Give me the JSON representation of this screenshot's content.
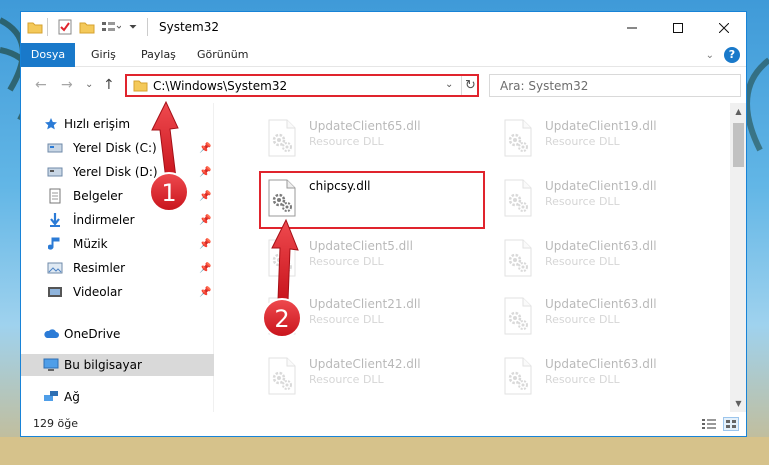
{
  "window": {
    "title": "System32"
  },
  "ribbon": {
    "tabs": [
      "Dosya",
      "Giriş",
      "Paylaş",
      "Görünüm"
    ]
  },
  "address": {
    "path": "C:\\Windows\\System32",
    "search_placeholder": "Ara: System32"
  },
  "sidebar": {
    "items": [
      {
        "label": "Hızlı erişim",
        "icon": "star-icon"
      },
      {
        "label": "Yerel Disk (C:)",
        "icon": "drive-icon",
        "pinned": true
      },
      {
        "label": "Yerel Disk (D:)",
        "icon": "drive-icon",
        "pinned": true
      },
      {
        "label": "Belgeler",
        "icon": "documents-icon",
        "pinned": true
      },
      {
        "label": "İndirmeler",
        "icon": "download-icon",
        "pinned": true
      },
      {
        "label": "Müzik",
        "icon": "music-icon",
        "pinned": true
      },
      {
        "label": "Resimler",
        "icon": "pictures-icon",
        "pinned": true
      },
      {
        "label": "Videolar",
        "icon": "video-icon",
        "pinned": true
      },
      {
        "label": "OneDrive",
        "icon": "cloud-icon"
      },
      {
        "label": "Bu bilgisayar",
        "icon": "computer-icon",
        "selected": true
      },
      {
        "label": "Ağ",
        "icon": "network-icon"
      }
    ]
  },
  "files": {
    "left": [
      {
        "name": "UpdateClient65.dll",
        "type": "Resource DLL",
        "faded": true
      },
      {
        "name": "chipcsy.dll",
        "type": "",
        "faded": false
      },
      {
        "name": "UpdateClient5.dll",
        "type": "Resource DLL",
        "faded": true
      },
      {
        "name": "UpdateClient21.dll",
        "type": "Resource DLL",
        "faded": true
      },
      {
        "name": "UpdateClient42.dll",
        "type": "Resource DLL",
        "faded": true
      }
    ],
    "right": [
      {
        "name": "UpdateClient19.dll",
        "type": "Resource DLL",
        "faded": true
      },
      {
        "name": "UpdateClient19.dll",
        "type": "Resource DLL",
        "faded": true
      },
      {
        "name": "UpdateClient63.dll",
        "type": "Resource DLL",
        "faded": true
      },
      {
        "name": "UpdateClient63.dll",
        "type": "Resource DLL",
        "faded": true
      },
      {
        "name": "UpdateClient63.dll",
        "type": "Resource DLL",
        "faded": true
      }
    ]
  },
  "status": {
    "count": "129 öğe"
  },
  "annotations": {
    "step1": "1",
    "step2": "2"
  },
  "colors": {
    "accent": "#1979ca",
    "highlight_red": "#e0242d",
    "selected_bg": "#d9d9d9"
  }
}
